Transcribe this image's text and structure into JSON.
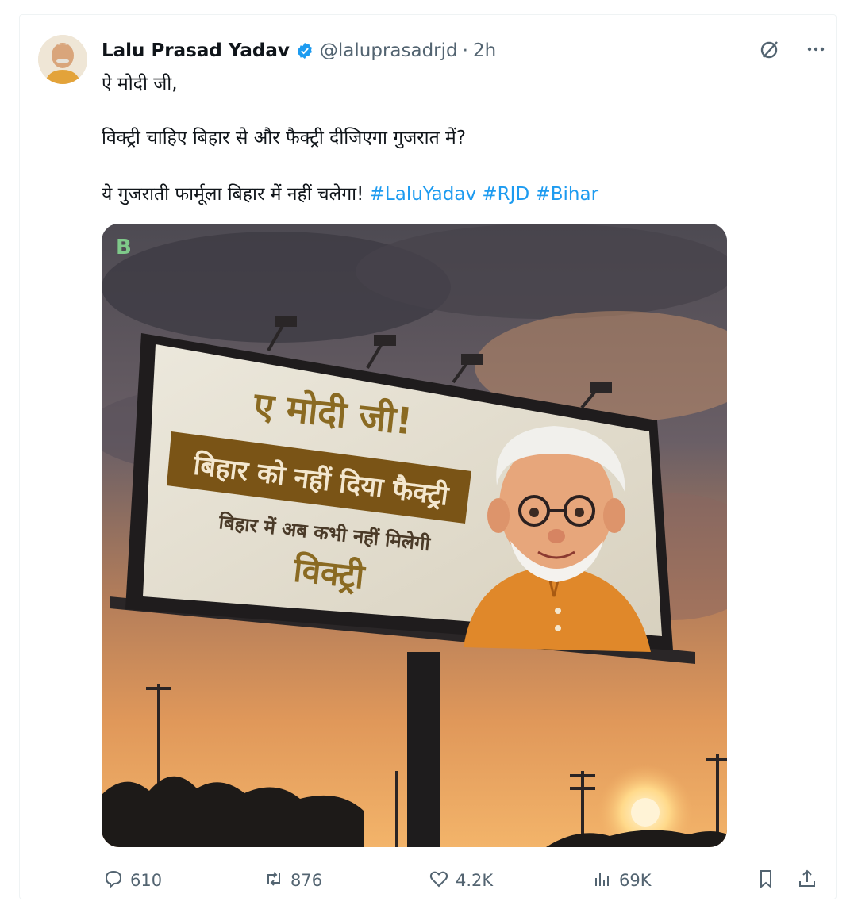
{
  "post": {
    "author_name": "Lalu Prasad Yadav",
    "handle": "@laluprasadrjd",
    "separator": "·",
    "time": "2h",
    "line1": "ऐ मोदी जी,",
    "line2": "विक्ट्री चाहिए बिहार से और फैक्ट्री दीजिएगा गुजरात में?",
    "line3": "ये गुजराती फार्मूला बिहार में नहीं चलेगा!",
    "hashtags": [
      "#LaluYadav",
      "#RJD",
      "#Bihar"
    ]
  },
  "billboard": {
    "logo_letter": "B",
    "headline": "ए मोदी जी!",
    "banner": "बिहार को नहीं दिया फैक्ट्री",
    "subline": "बिहार में अब कभी नहीं मिलेगी",
    "bottom": "विक्ट्री"
  },
  "actions": {
    "replies": "610",
    "reposts": "876",
    "likes": "4.2K",
    "views": "69K"
  },
  "icons": {
    "verified": "verified-badge-icon",
    "grok": "grok-icon",
    "more": "more-icon",
    "reply": "reply-icon",
    "repost": "repost-icon",
    "like": "heart-icon",
    "views": "views-icon",
    "bookmark": "bookmark-icon",
    "share": "share-icon"
  },
  "colors": {
    "accent": "#1d9bf0",
    "muted": "#536471",
    "billboard_banner": "#7a5416",
    "billboard_text": "#8a6a22"
  }
}
